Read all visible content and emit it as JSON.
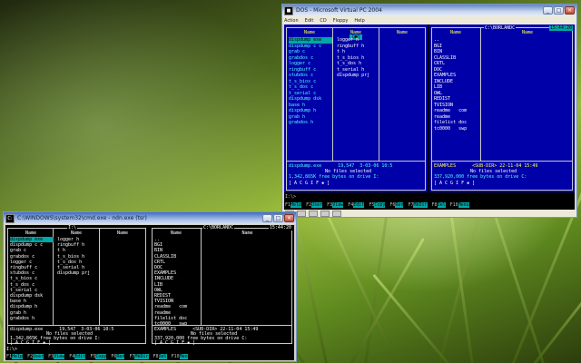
{
  "dosbox": {
    "title": "DOS - Microsoft Virtual PC 2004",
    "menu": [
      "Action",
      "Edit",
      "CD",
      "Floppy",
      "Help"
    ],
    "left_panel": {
      "title": "[■]",
      "headers": [
        "Name",
        "Name",
        "Name"
      ],
      "col1": [
        "dispdump exe",
        "dispdump c",
        "grab",
        "grabdos",
        "logger",
        "ringbuff",
        "stubdos",
        "t_s_bios",
        "t_s_dos",
        "t_serial",
        "dispdump dsk",
        "base",
        "dispdump",
        "grab",
        "grabdos"
      ],
      "col1_ext": [
        "",
        "c",
        "c",
        "c",
        "c",
        "c",
        "c",
        "c",
        "c",
        "c",
        "",
        "h",
        "h",
        "h",
        "h"
      ],
      "col2": [
        "logger",
        "ringbuff",
        "t",
        "t_s_bios",
        "t_s_dos",
        "t_serial",
        "dispdump prj"
      ],
      "col2_ext": [
        "h",
        "h",
        "h",
        "h",
        "h",
        "h",
        ""
      ],
      "file_info": "dispdump.exe      19,547  3-03-06 10:5",
      "summary": "1,342,865K free bytes on drive I:",
      "selection": "No files selected",
      "attrs": "[ A C G I F ▪ ]"
    },
    "right_panel": {
      "path": "C:\\BORLANDC",
      "clock": "15:44:20",
      "headers": [
        "Name",
        "Name"
      ],
      "col1": [
        "..",
        "BGI",
        "BIN",
        "CLASSLIB",
        "CRTL",
        "DOC",
        "EXAMPLES",
        "INCLUDE",
        "LIB",
        "OWL",
        "REDIST",
        "TVISION",
        "readme   com",
        "readme",
        "filelist doc",
        "tc0000   swp"
      ],
      "file_info": "EXAMPLES      <SUB-DIR> 22-11-04 15:49",
      "summary": "337,920,000 free bytes on drive C:",
      "selection": "No files selected",
      "attrs": "[ A C G I F ▪ ]"
    },
    "prompt": "I:\\>",
    "keybar": [
      {
        "n": "F1",
        "l": "Help"
      },
      {
        "n": "F2",
        "l": "User"
      },
      {
        "n": "F3",
        "l": "View"
      },
      {
        "n": "F4",
        "l": "Edit"
      },
      {
        "n": "F5",
        "l": "Copy"
      },
      {
        "n": "F6",
        "l": "Ren"
      },
      {
        "n": "F7",
        "l": "MkDir"
      },
      {
        "n": "F8",
        "l": "Del"
      },
      {
        "n": "F10",
        "l": "Menu"
      }
    ]
  },
  "cmd": {
    "title": "C:\\WINDOWS\\system32\\cmd.exe - ndn.exe (tsr)",
    "left_panel": {
      "path": "I:\\",
      "headers": [
        "Name",
        "Name",
        "Name"
      ],
      "col1": [
        "dispdump exe",
        "dispdump c",
        "grab",
        "grabdos",
        "logger",
        "ringbuff",
        "stubdos",
        "t_s_bios",
        "t_s_dos",
        "t_serial",
        "dispdump dsk",
        "base",
        "dispdump",
        "grab",
        "grabdos"
      ],
      "col1_ext": [
        "",
        "c",
        "c",
        "c",
        "c",
        "c",
        "c",
        "c",
        "c",
        "c",
        "",
        "h",
        "h",
        "h",
        "h"
      ],
      "col2": [
        "logger",
        "ringbuff",
        "t",
        "t_s_bios",
        "t_s_dos",
        "t_serial",
        "dispdump prj"
      ],
      "col2_ext": [
        "h",
        "h",
        "h",
        "h",
        "h",
        "h",
        ""
      ],
      "file_info": "dispdump.exe      19,547  3-03-06 10:5",
      "selection": "No files selected",
      "summary": "1,342,865K free bytes on drive I:",
      "attrs": "[ A C G I F ▪ ]"
    },
    "right_panel": {
      "path": "C:\\BORLANDC",
      "clock": "15:44:20",
      "headers": [
        "Name",
        "Name"
      ],
      "col1": [
        "..",
        "BGI",
        "BIN",
        "CLASSLIB",
        "CRTL",
        "DOC",
        "EXAMPLES",
        "INCLUDE",
        "LIB",
        "OWL",
        "REDIST",
        "TVISION",
        "readme   com",
        "readme",
        "filelist doc",
        "tc0000   swp"
      ],
      "file_info": "EXAMPLES      <SUB-DIR> 22-11-04 15:49",
      "selection": "No files selected",
      "summary": "337,920,000 free bytes on drive C:",
      "attrs": "[ A C G I F ▪ ]"
    },
    "prompt": "I:\\>",
    "keybar": [
      {
        "n": "F1",
        "l": "Help"
      },
      {
        "n": "F2",
        "l": "User"
      },
      {
        "n": "F3",
        "l": "View"
      },
      {
        "n": "F4",
        "l": "Edit"
      },
      {
        "n": "F5",
        "l": "Copy"
      },
      {
        "n": "F6",
        "l": "Ren"
      },
      {
        "n": "F7",
        "l": "MkDir"
      },
      {
        "n": "F8",
        "l": "Del"
      },
      {
        "n": "F10",
        "l": "Men"
      }
    ]
  },
  "window_buttons": {
    "minimize": "_",
    "maximize": "□",
    "close": "×"
  },
  "colors": {
    "panel_blue": "#0000a8",
    "cyan": "#00a8a8",
    "file_cyan": "#54ffff",
    "header_yellow": "#ffff54"
  }
}
